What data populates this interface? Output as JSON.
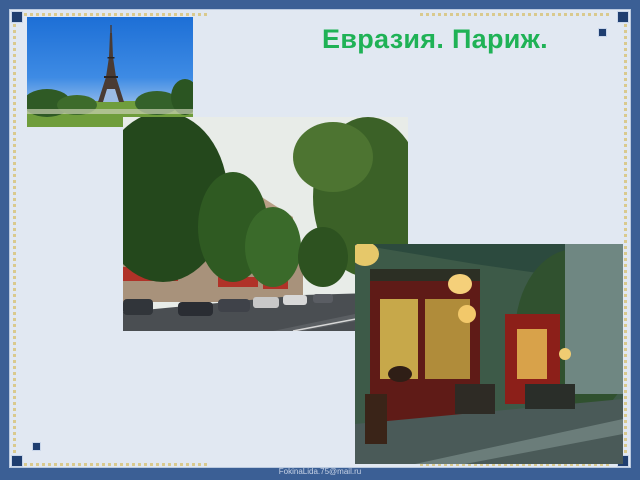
{
  "slide": {
    "title": "Евразия. Париж.",
    "footer": "FokinaLida.75@mail.ru"
  },
  "images": [
    {
      "name": "eiffel-tower-photo"
    },
    {
      "name": "paris-street-photo"
    },
    {
      "name": "paris-cafe-painting"
    }
  ],
  "colors": {
    "background": "#3b5f95",
    "slide": "#e1e8f2",
    "title": "#1fb256"
  }
}
